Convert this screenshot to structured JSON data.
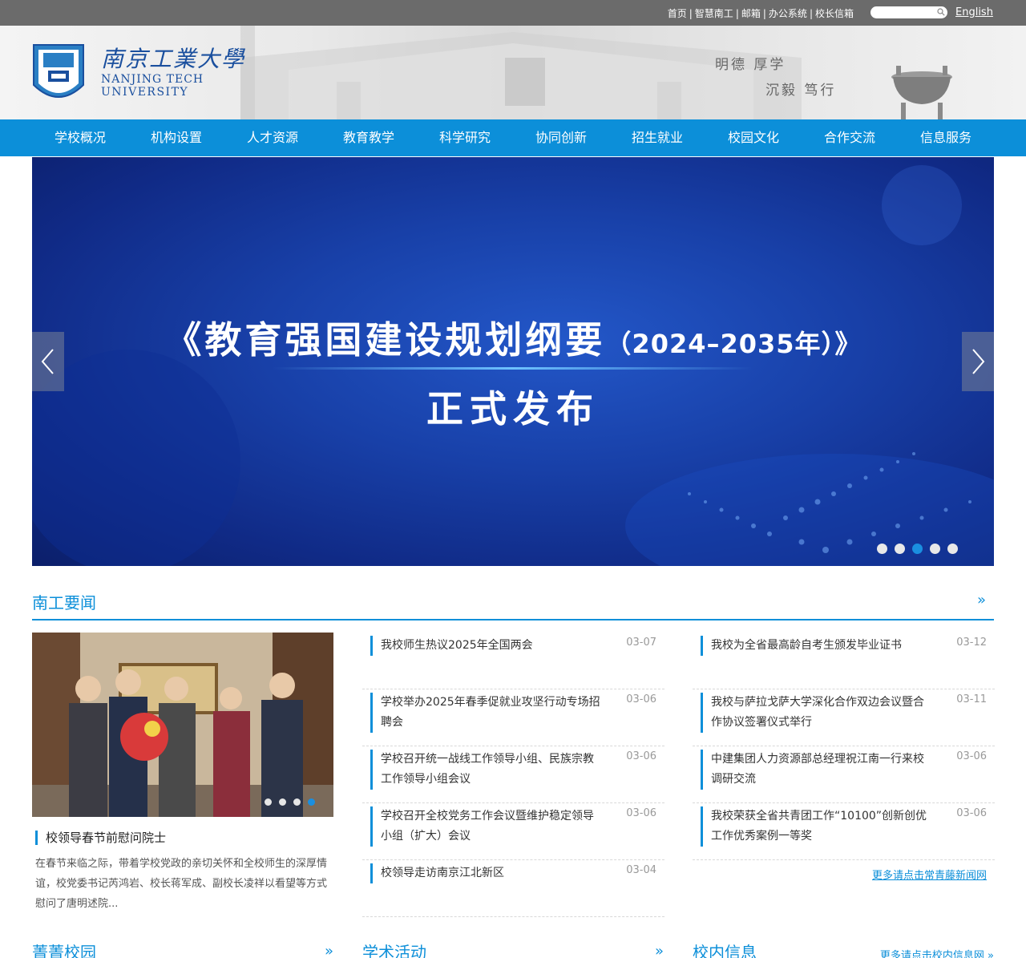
{
  "topbar": {
    "links": [
      "首页",
      "智慧南工",
      "邮箱",
      "办公系统",
      "校长信箱"
    ],
    "separator": "|",
    "search_placeholder": "",
    "language": "English"
  },
  "header": {
    "logo_cn": "南京工業大學",
    "logo_en_line1": "NANJING TECH",
    "logo_en_line2": "UNIVERSITY",
    "motto_line1": "明德  厚学",
    "motto_line2": "沉毅  笃行"
  },
  "nav": {
    "items": [
      "学校概况",
      "机构设置",
      "人才资源",
      "教育教学",
      "科学研究",
      "协同创新",
      "招生就业",
      "校园文化",
      "合作交流",
      "信息服务"
    ]
  },
  "banner": {
    "title_main": "《教育强国建设规划纲要",
    "title_paren": "（2024–2035年）》",
    "subtitle": "正式发布",
    "dot_count": 5,
    "active_dot": 3
  },
  "news": {
    "section_title": "南工要闻",
    "more_symbol": "»",
    "featured": {
      "title": "校领导春节前慰问院士",
      "description": "在春节来临之际，带着学校党政的亲切关怀和全校师生的深厚情谊，校党委书记芮鸿岩、校长蒋军成、副校长凌祥以看望等方式慰问了唐明述院..."
    },
    "column1": [
      {
        "title": "我校师生热议2025年全国两会",
        "date": "03-07"
      },
      {
        "title": "学校举办2025年春季促就业攻坚行动专场招聘会",
        "date": "03-06"
      },
      {
        "title": "学校召开统一战线工作领导小组、民族宗教工作领导小组会议",
        "date": "03-06"
      },
      {
        "title": "学校召开全校党务工作会议暨维护稳定领导小组（扩大）会议",
        "date": "03-06"
      },
      {
        "title": "校领导走访南京江北新区",
        "date": "03-04"
      }
    ],
    "column2": [
      {
        "title": "我校为全省最高龄自考生颁发毕业证书",
        "date": "03-12"
      },
      {
        "title": "我校与萨拉戈萨大学深化合作双边会议暨合作协议签署仪式举行",
        "date": "03-11"
      },
      {
        "title": "中建集团人力资源部总经理祝江南一行来校调研交流",
        "date": "03-06"
      },
      {
        "title": "我校荣获全省共青团工作“10100”创新创优工作优秀案例一等奖",
        "date": "03-06"
      }
    ],
    "column2_more": "更多请点击常青藤新闻网"
  },
  "bottom_sections": [
    {
      "title": "菁菁校园",
      "more": "»"
    },
    {
      "title": "学术活动",
      "more": "»"
    },
    {
      "title": "校内信息",
      "more": "更多请点击校内信息网 »"
    }
  ],
  "colors": {
    "brand_blue": "#0c8fd9",
    "topbar_gray": "#6b6b6b",
    "logo_blue": "#1a4f9e"
  }
}
